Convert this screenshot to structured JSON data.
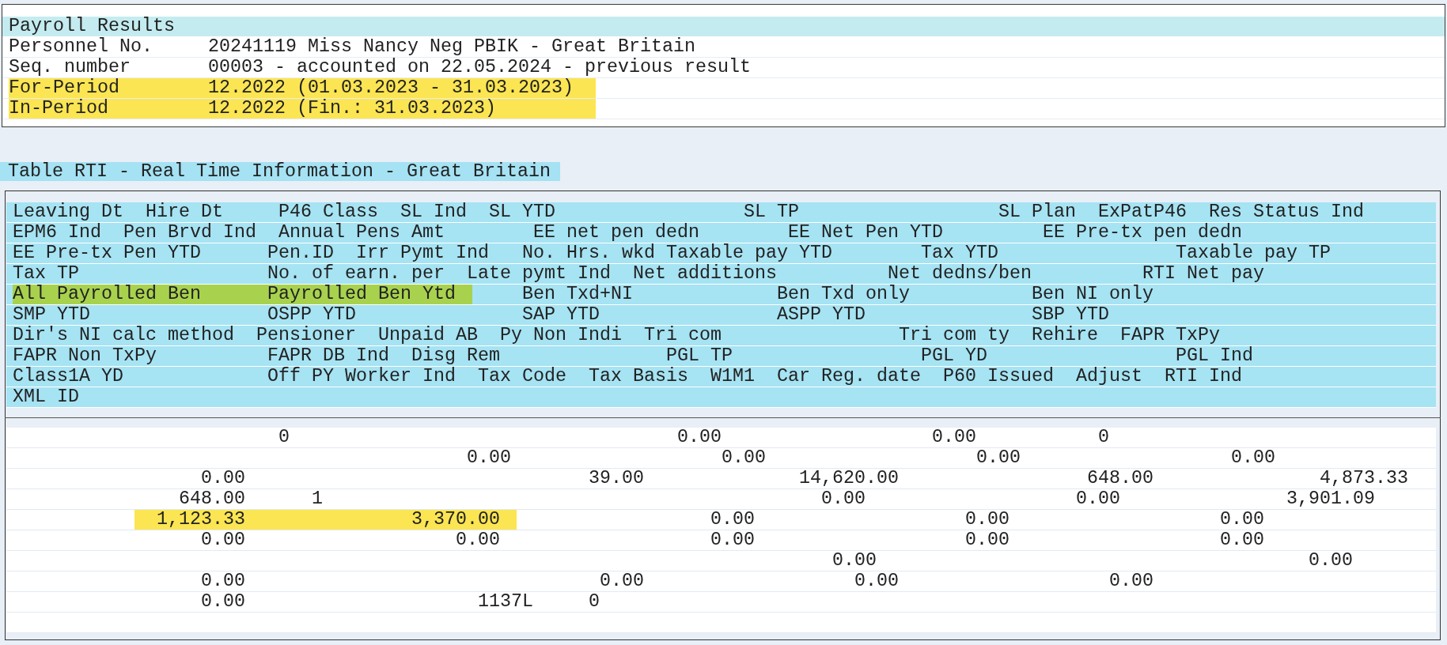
{
  "summary": {
    "title": "Payroll Results",
    "rows": [
      {
        "label": "Personnel No.",
        "value": "20241119 Miss Nancy Neg PBIK - Great Britain",
        "highlighted": false
      },
      {
        "label": "Seq. number",
        "value": "00003 - accounted on 22.05.2024 - previous result",
        "highlighted": false
      },
      {
        "label": "For-Period",
        "value": "12.2022 (01.03.2023 - 31.03.2023)",
        "highlighted": true
      },
      {
        "label": "In-Period",
        "value": "12.2022 (Fin.: 31.03.2023)",
        "highlighted": true
      }
    ]
  },
  "table": {
    "title": "Table RTI - Real Time Information - Great Britain",
    "header_lines": [
      {
        "cells": [
          {
            "text": "Leaving Dt",
            "highlighted": false
          },
          {
            "text": "Hire Dt",
            "highlighted": false
          },
          {
            "text": "P46 Class",
            "highlighted": false
          },
          {
            "text": "SL Ind",
            "highlighted": false
          },
          {
            "text": "SL YTD",
            "highlighted": false
          },
          {
            "text": "SL TP",
            "highlighted": false
          },
          {
            "text": "SL Plan",
            "highlighted": false
          },
          {
            "text": "ExPatP46",
            "highlighted": false
          },
          {
            "text": "Res Status Ind",
            "highlighted": false
          }
        ]
      },
      {
        "cells": [
          {
            "text": "EPM6 Ind",
            "highlighted": false
          },
          {
            "text": "Pen Brvd Ind",
            "highlighted": false
          },
          {
            "text": "Annual Pens Amt",
            "highlighted": false
          },
          {
            "text": "EE net pen dedn",
            "highlighted": false
          },
          {
            "text": "EE Net Pen YTD",
            "highlighted": false
          },
          {
            "text": "EE Pre-tx pen dedn",
            "highlighted": false
          }
        ]
      },
      {
        "cells": [
          {
            "text": "EE Pre-tx Pen YTD",
            "highlighted": false
          },
          {
            "text": "Pen.ID",
            "highlighted": false
          },
          {
            "text": "Irr Pymt Ind",
            "highlighted": false
          },
          {
            "text": "No. Hrs. wkd",
            "highlighted": false
          },
          {
            "text": "Taxable pay YTD",
            "highlighted": false
          },
          {
            "text": "Tax YTD",
            "highlighted": false
          },
          {
            "text": "Taxable pay TP",
            "highlighted": false
          }
        ]
      },
      {
        "cells": [
          {
            "text": "Tax TP",
            "highlighted": false
          },
          {
            "text": "No. of earn. per",
            "highlighted": false
          },
          {
            "text": "Late pymt Ind",
            "highlighted": false
          },
          {
            "text": "Net additions",
            "highlighted": false
          },
          {
            "text": "Net dedns/ben",
            "highlighted": false
          },
          {
            "text": "RTI Net pay",
            "highlighted": false
          }
        ]
      },
      {
        "cells": [
          {
            "text": "All Payrolled Ben",
            "highlighted": true
          },
          {
            "text": "Payrolled Ben Ytd",
            "highlighted": true
          },
          {
            "text": "Ben Txd+NI",
            "highlighted": false
          },
          {
            "text": "Ben Txd only",
            "highlighted": false
          },
          {
            "text": "Ben NI only",
            "highlighted": false
          }
        ]
      },
      {
        "cells": [
          {
            "text": "SMP YTD",
            "highlighted": false
          },
          {
            "text": "OSPP YTD",
            "highlighted": false
          },
          {
            "text": "SAP YTD",
            "highlighted": false
          },
          {
            "text": "ASPP YTD",
            "highlighted": false
          },
          {
            "text": "SBP YTD",
            "highlighted": false
          }
        ]
      },
      {
        "cells": [
          {
            "text": "Dir's NI calc method",
            "highlighted": false
          },
          {
            "text": "Pensioner",
            "highlighted": false
          },
          {
            "text": "Unpaid AB",
            "highlighted": false
          },
          {
            "text": "Py Non Indi",
            "highlighted": false
          },
          {
            "text": "Tri com",
            "highlighted": false
          },
          {
            "text": "Tri com ty",
            "highlighted": false
          },
          {
            "text": "Rehire",
            "highlighted": false
          },
          {
            "text": "FAPR TxPy",
            "highlighted": false
          }
        ]
      },
      {
        "cells": [
          {
            "text": "FAPR Non TxPy",
            "highlighted": false
          },
          {
            "text": "FAPR DB Ind",
            "highlighted": false
          },
          {
            "text": "Disg Rem",
            "highlighted": false
          },
          {
            "text": "PGL TP",
            "highlighted": false
          },
          {
            "text": "PGL YD",
            "highlighted": false
          },
          {
            "text": "PGL Ind",
            "highlighted": false
          }
        ]
      },
      {
        "cells": [
          {
            "text": "Class1A YD",
            "highlighted": false
          },
          {
            "text": "Off PY Worker Ind",
            "highlighted": false
          },
          {
            "text": "Tax Code",
            "highlighted": false
          },
          {
            "text": "Tax Basis",
            "highlighted": false
          },
          {
            "text": "W1M1",
            "highlighted": false
          },
          {
            "text": "Car Reg. date",
            "highlighted": false
          },
          {
            "text": "P60 Issued",
            "highlighted": false
          },
          {
            "text": "Adjust",
            "highlighted": false
          },
          {
            "text": "RTI Ind",
            "highlighted": false
          }
        ]
      },
      {
        "cells": [
          {
            "text": "XML ID",
            "highlighted": false
          }
        ]
      }
    ],
    "data_lines": [
      {
        "cells": [
          {
            "text": "0",
            "highlighted": false
          },
          {
            "text": "0.00",
            "highlighted": false
          },
          {
            "text": "0.00",
            "highlighted": false
          },
          {
            "text": "0",
            "highlighted": false
          }
        ]
      },
      {
        "cells": [
          {
            "text": "0.00",
            "highlighted": false
          },
          {
            "text": "0.00",
            "highlighted": false
          },
          {
            "text": "0.00",
            "highlighted": false
          },
          {
            "text": "0.00",
            "highlighted": false
          }
        ]
      },
      {
        "cells": [
          {
            "text": "0.00",
            "highlighted": false
          },
          {
            "text": "39.00",
            "highlighted": false
          },
          {
            "text": "14,620.00",
            "highlighted": false
          },
          {
            "text": "648.00",
            "highlighted": false
          },
          {
            "text": "4,873.33",
            "highlighted": false
          }
        ]
      },
      {
        "cells": [
          {
            "text": "648.00",
            "highlighted": false
          },
          {
            "text": "1",
            "highlighted": false
          },
          {
            "text": "0.00",
            "highlighted": false
          },
          {
            "text": "0.00",
            "highlighted": false
          },
          {
            "text": "3,901.09",
            "highlighted": false
          }
        ]
      },
      {
        "cells": [
          {
            "text": "1,123.33",
            "highlighted": true
          },
          {
            "text": "3,370.00",
            "highlighted": true
          },
          {
            "text": "0.00",
            "highlighted": false
          },
          {
            "text": "0.00",
            "highlighted": false
          },
          {
            "text": "0.00",
            "highlighted": false
          }
        ]
      },
      {
        "cells": [
          {
            "text": "0.00",
            "highlighted": false
          },
          {
            "text": "0.00",
            "highlighted": false
          },
          {
            "text": "0.00",
            "highlighted": false
          },
          {
            "text": "0.00",
            "highlighted": false
          },
          {
            "text": "0.00",
            "highlighted": false
          }
        ]
      },
      {
        "cells": [
          {
            "text": "0.00",
            "highlighted": false
          },
          {
            "text": "0.00",
            "highlighted": false
          }
        ]
      },
      {
        "cells": [
          {
            "text": "0.00",
            "highlighted": false
          },
          {
            "text": "0.00",
            "highlighted": false
          },
          {
            "text": "0.00",
            "highlighted": false
          },
          {
            "text": "0.00",
            "highlighted": false
          }
        ]
      },
      {
        "cells": [
          {
            "text": "0.00",
            "highlighted": false
          },
          {
            "text": "1137L",
            "highlighted": false
          },
          {
            "text": "0",
            "highlighted": false
          }
        ]
      }
    ]
  }
}
